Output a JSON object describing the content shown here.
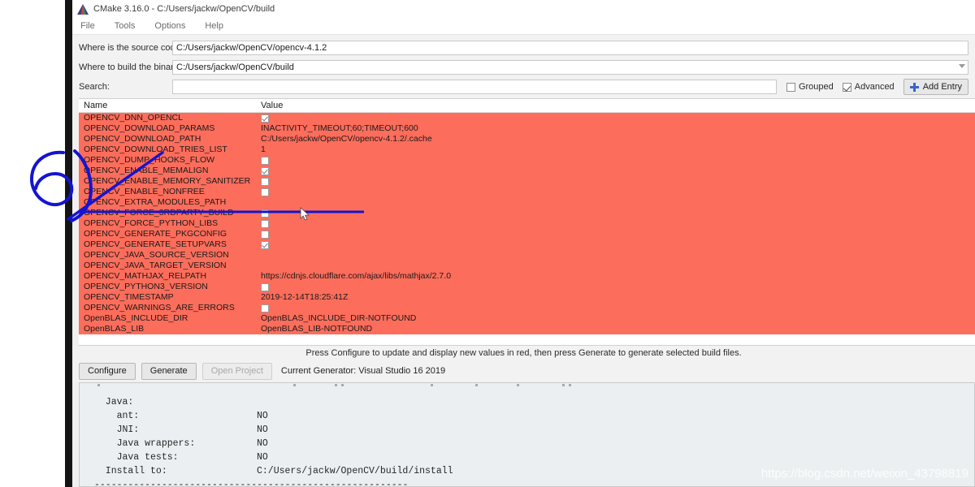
{
  "window": {
    "title": "CMake 3.16.0 - C:/Users/jackw/OpenCV/build",
    "logo_icon": "cmake-triangle-logo"
  },
  "menu": {
    "items": [
      {
        "label": "File"
      },
      {
        "label": "Tools"
      },
      {
        "label": "Options"
      },
      {
        "label": "Help"
      }
    ]
  },
  "paths": {
    "source_label": "Where is the source code:",
    "source_value": "C:/Users/jackw/OpenCV/opencv-4.1.2",
    "build_label": "Where to build the binaries:",
    "build_value": "C:/Users/jackw/OpenCV/build",
    "build_dropdown_icon": "chevron-down-icon"
  },
  "search": {
    "label": "Search:",
    "value": "",
    "placeholder": ""
  },
  "options": {
    "grouped_label": "Grouped",
    "grouped_checked": false,
    "advanced_label": "Advanced",
    "advanced_checked": true,
    "add_entry_label": "Add Entry",
    "add_entry_icon": "plus-icon"
  },
  "table": {
    "header": {
      "name": "Name",
      "value": "Value"
    },
    "highlight_color": "#fd6d5b",
    "rows": [
      {
        "name": "OPENCV_DNN_OPENCL",
        "type": "checkbox",
        "checked": true,
        "value": ""
      },
      {
        "name": "OPENCV_DOWNLOAD_PARAMS",
        "type": "text",
        "value": "INACTIVITY_TIMEOUT;60;TIMEOUT;600"
      },
      {
        "name": "OPENCV_DOWNLOAD_PATH",
        "type": "text",
        "value": "C:/Users/jackw/OpenCV/opencv-4.1.2/.cache"
      },
      {
        "name": "OPENCV_DOWNLOAD_TRIES_LIST",
        "type": "text",
        "value": "1"
      },
      {
        "name": "OPENCV_DUMP_HOOKS_FLOW",
        "type": "checkbox",
        "checked": false,
        "value": ""
      },
      {
        "name": "OPENCV_ENABLE_MEMALIGN",
        "type": "checkbox",
        "checked": true,
        "value": ""
      },
      {
        "name": "OPENCV_ENABLE_MEMORY_SANITIZER",
        "type": "checkbox",
        "checked": false,
        "value": ""
      },
      {
        "name": "OPENCV_ENABLE_NONFREE",
        "type": "checkbox",
        "checked": false,
        "value": ""
      },
      {
        "name": "OPENCV_EXTRA_MODULES_PATH",
        "type": "text",
        "value": ""
      },
      {
        "name": "OPENCV_FORCE_3RDPARTY_BUILD",
        "type": "checkbox",
        "checked": false,
        "value": ""
      },
      {
        "name": "OPENCV_FORCE_PYTHON_LIBS",
        "type": "checkbox",
        "checked": false,
        "value": ""
      },
      {
        "name": "OPENCV_GENERATE_PKGCONFIG",
        "type": "checkbox",
        "checked": false,
        "value": ""
      },
      {
        "name": "OPENCV_GENERATE_SETUPVARS",
        "type": "checkbox",
        "checked": true,
        "value": ""
      },
      {
        "name": "OPENCV_JAVA_SOURCE_VERSION",
        "type": "text",
        "value": ""
      },
      {
        "name": "OPENCV_JAVA_TARGET_VERSION",
        "type": "text",
        "value": ""
      },
      {
        "name": "OPENCV_MATHJAX_RELPATH",
        "type": "text",
        "value": "https://cdnjs.cloudflare.com/ajax/libs/mathjax/2.7.0"
      },
      {
        "name": "OPENCV_PYTHON3_VERSION",
        "type": "checkbox",
        "checked": false,
        "value": ""
      },
      {
        "name": "OPENCV_TIMESTAMP",
        "type": "text",
        "value": "2019-12-14T18:25:41Z"
      },
      {
        "name": "OPENCV_WARNINGS_ARE_ERRORS",
        "type": "checkbox",
        "checked": false,
        "value": ""
      },
      {
        "name": "OpenBLAS_INCLUDE_DIR",
        "type": "text",
        "value": "OpenBLAS_INCLUDE_DIR-NOTFOUND"
      },
      {
        "name": "OpenBLAS_LIB",
        "type": "text",
        "value": "OpenBLAS_LIB-NOTFOUND"
      }
    ]
  },
  "status": {
    "message": "Press Configure to update and display new values in red, then press Generate to generate selected build files."
  },
  "actions": {
    "configure_label": "Configure",
    "generate_label": "Generate",
    "open_project_label": "Open Project",
    "open_project_disabled": true,
    "generator_text": "Current Generator: Visual Studio 16 2019"
  },
  "log": {
    "lines": [
      {
        "key": "  Java:",
        "value": ""
      },
      {
        "key": "    ant:",
        "value": "NO"
      },
      {
        "key": "    JNI:",
        "value": "NO"
      },
      {
        "key": "    Java wrappers:",
        "value": "NO"
      },
      {
        "key": "    Java tests:",
        "value": "NO"
      },
      {
        "key": "",
        "value": ""
      },
      {
        "key": "  Install to:",
        "value": "C:/Users/jackw/OpenCV/build/install"
      },
      {
        "key": "--------------------------------------------------------",
        "value": ""
      }
    ]
  },
  "annotations": {
    "handwritten_mark": "6",
    "mark_color": "#1414d2",
    "watermark": "https://blog.csdn.net/weixin_43798819"
  }
}
